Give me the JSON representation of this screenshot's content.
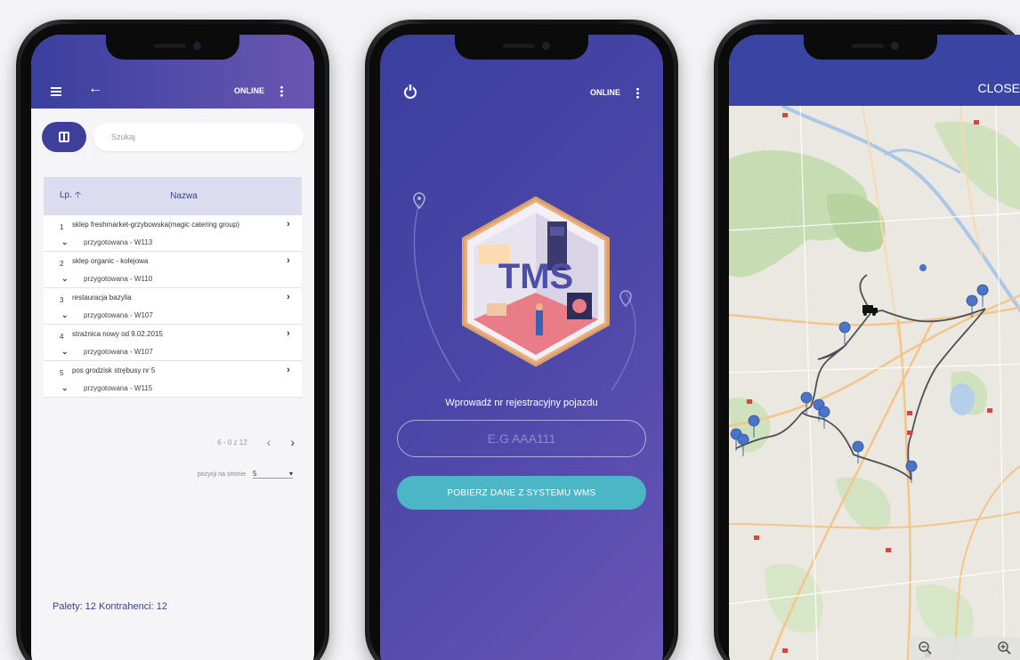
{
  "phone1": {
    "status": {
      "online_label": "ONLINE"
    },
    "search": {
      "placeholder": "Szukaj"
    },
    "table": {
      "col_lp": "Lp.",
      "col_nazwa": "Nazwa",
      "rows": [
        {
          "num": "1",
          "name": "sklep freshmarket-grzybowska(magic catering group)",
          "status": "przygotowana - W113"
        },
        {
          "num": "2",
          "name": "sklep organic - kolejowa",
          "status": "przygotowana - W110"
        },
        {
          "num": "3",
          "name": "restauracja bazylia",
          "status": "przygotowana - W107"
        },
        {
          "num": "4",
          "name": "strażnica nowy od 9.02.2015",
          "status": "przygotowana - W107"
        },
        {
          "num": "5",
          "name": "pos grodzisk strębusy nr 5",
          "status": "przygotowana - W115"
        }
      ]
    },
    "pager": {
      "range": "6 - 0 z 12"
    },
    "per_page": {
      "label": "pozycji na stronie",
      "value": "5"
    },
    "footer": "Palety: 12 Kontrahenci: 12"
  },
  "phone2": {
    "status": {
      "online_label": "ONLINE"
    },
    "logo_text": "TMS",
    "prompt": "Wprowadź nr rejestracyjny pojazdu",
    "plate_placeholder": "E.G AAA111",
    "fetch_button": "POBIERZ DANE Z SYSTEMU WMS"
  },
  "phone3": {
    "close_label": "CLOSE"
  },
  "colors": {
    "primary": "#3a3f9e",
    "accent": "#4bb7c6",
    "route": "#444a55",
    "pin": "#4a74c9"
  }
}
